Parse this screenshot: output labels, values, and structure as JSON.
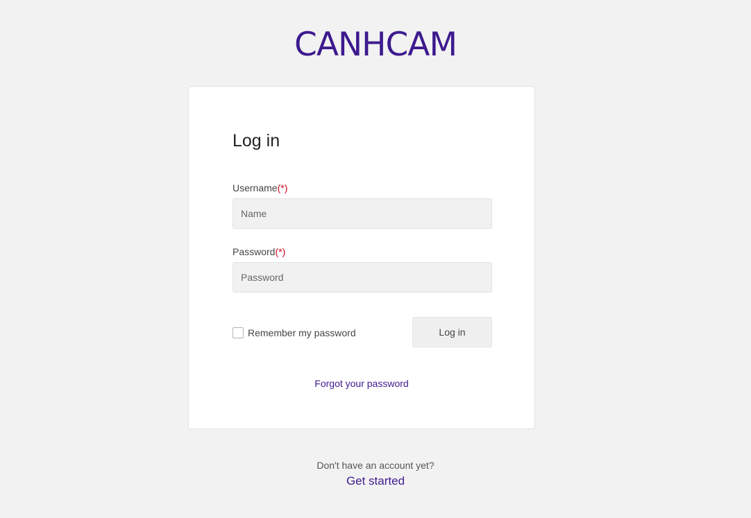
{
  "brand": {
    "logo_text": "CANHCAM",
    "color": "#3d1a8e"
  },
  "login_form": {
    "title": "Log in",
    "required_marker": "(*)",
    "username": {
      "label": "Username",
      "placeholder": "Name",
      "value": ""
    },
    "password": {
      "label": "Password",
      "placeholder": "Password",
      "value": ""
    },
    "remember": {
      "label": "Remember my password",
      "checked": false
    },
    "submit_label": "Log in",
    "forgot_link": "Forgot your password"
  },
  "footer": {
    "prompt": "Don't have an account yet?",
    "signup_link": "Get started"
  },
  "colors": {
    "background": "#f2f2f2",
    "card": "#ffffff",
    "accent": "#3d1a8e",
    "required": "#d0021b"
  }
}
